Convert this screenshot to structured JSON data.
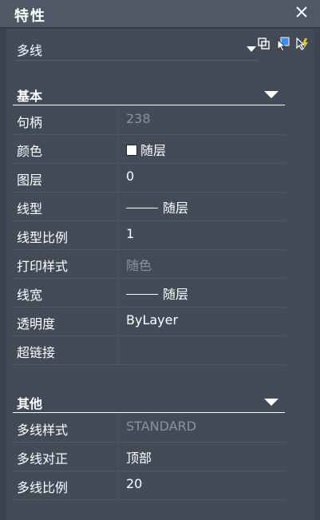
{
  "window": {
    "title": "特性"
  },
  "selector": {
    "value": "多线"
  },
  "sections": {
    "basic": {
      "title": "基本",
      "rows": [
        {
          "label": "句柄",
          "value": "238"
        },
        {
          "label": "颜色",
          "value": "随层"
        },
        {
          "label": "图层",
          "value": "0"
        },
        {
          "label": "线型",
          "value": "随层"
        },
        {
          "label": "线型比例",
          "value": "1"
        },
        {
          "label": "打印样式",
          "value": "随色"
        },
        {
          "label": "线宽",
          "value": "随层"
        },
        {
          "label": "透明度",
          "value": "ByLayer"
        },
        {
          "label": "超链接",
          "value": ""
        }
      ]
    },
    "other": {
      "title": "其他",
      "rows": [
        {
          "label": "多线样式",
          "value": "STANDARD"
        },
        {
          "label": "多线对正",
          "value": "顶部"
        },
        {
          "label": "多线比例",
          "value": "20"
        }
      ]
    }
  },
  "icons": {
    "close": "close-icon",
    "toolbar": [
      "toggle-pickadd-icon",
      "select-objects-icon",
      "quick-select-icon"
    ],
    "color_swatch": "#ffffff"
  }
}
